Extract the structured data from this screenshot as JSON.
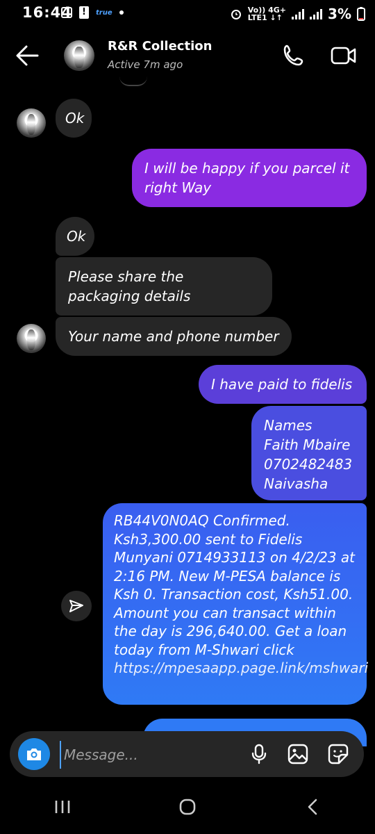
{
  "status_bar": {
    "time": "16:44",
    "true_label": "true",
    "network_top": "Vo)) 4G+",
    "network_bottom": "LTE1 ↓↑",
    "battery": "3%"
  },
  "header": {
    "contact_name": "R&R Collection",
    "contact_status": "Active 7m ago"
  },
  "messages": {
    "in_1": "Ok",
    "out_1": "I will be happy if you parcel it right Way",
    "in_2": "Ok",
    "in_3": "Please share the packaging details",
    "in_4": "Your name and phone number",
    "out_2": "I have paid to fidelis",
    "out_3_line1": "Names",
    "out_3_line2": "Faith Mbaire",
    "out_3_line3": "0702482483",
    "out_3_line4": "Naivasha",
    "out_4": "RB44V0N0AQ Confirmed. Ksh3,300.00 sent to Fidelis Munyani 0714933113 on 4/2/23 at 2:16 PM. New M-PESA balance is Ksh 0. Transaction cost, Ksh51.00. Amount you can transact within the day is 296,640.00. Get a loan today from M-Shwari click ",
    "out_4_link": "https://mpesaapp.page.link/mshwari"
  },
  "composer": {
    "placeholder": "Message..."
  },
  "colors": {
    "incoming": "#262626",
    "outgoing_purple": "#8a2be2",
    "outgoing_blue": "#2f6ef5",
    "camera": "#1e88e5"
  }
}
